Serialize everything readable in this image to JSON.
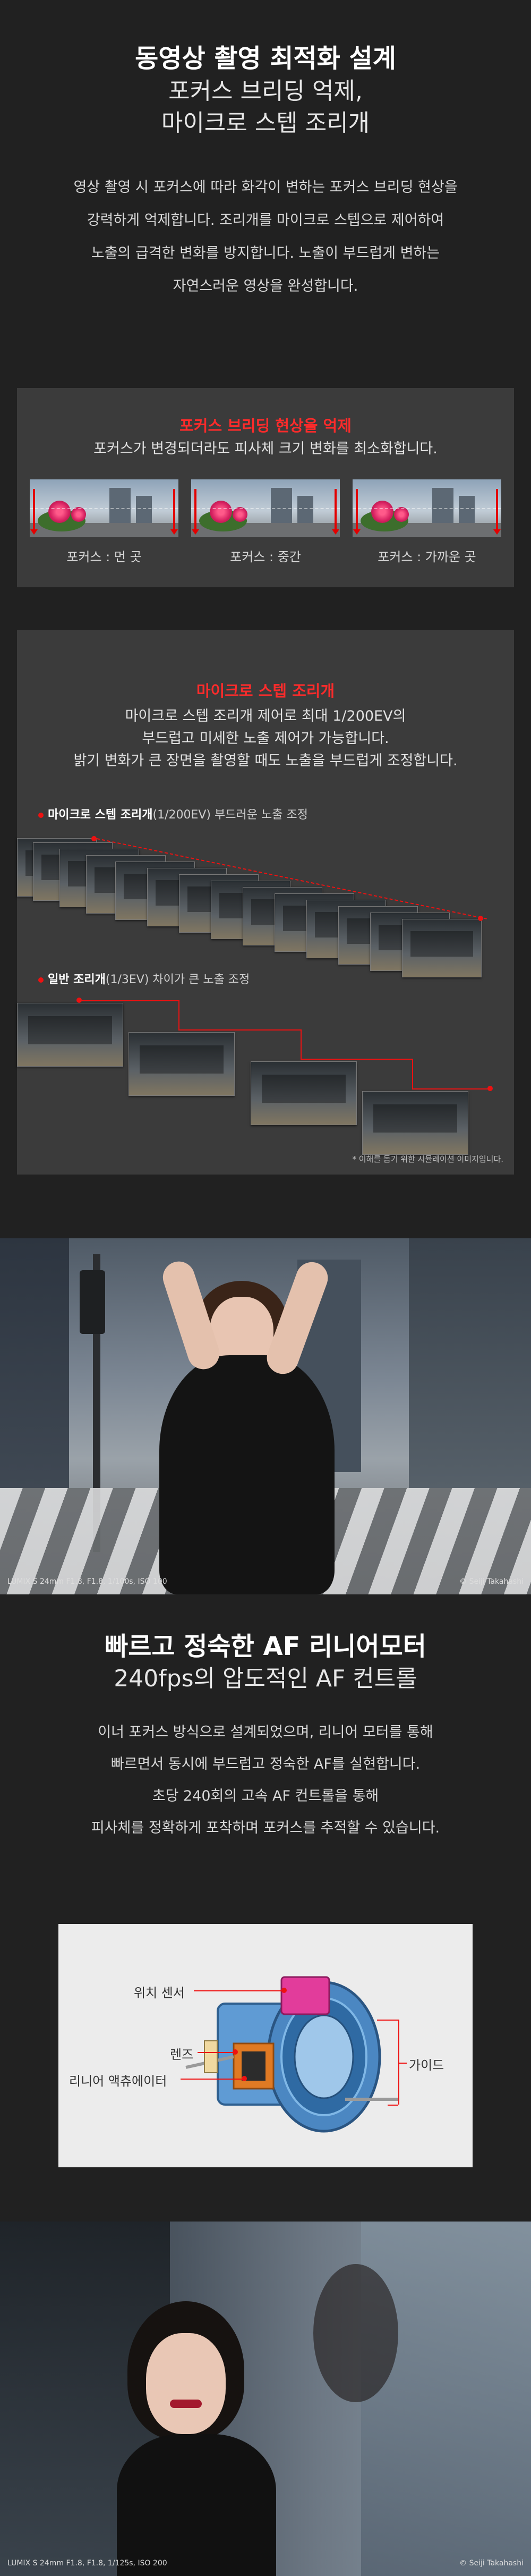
{
  "intro": {
    "title_bold": "동영상 촬영 최적화 설계",
    "title_line2": "포커스 브리딩 억제,",
    "title_line3": "마이크로 스텝 조리개",
    "body": [
      "영상 촬영 시 포커스에 따라 화각이 변하는 포커스 브리딩 현상을",
      "강력하게 억제합니다. 조리개를 마이크로 스텝으로 제어하여",
      "노출의 급격한 변화를 방지합니다. 노출이 부드럽게 변하는",
      "자연스러운 영상을 완성합니다."
    ]
  },
  "breathing": {
    "title": "포커스 브리딩 현상을 억제",
    "subtitle": "포커스가 변경되더라도 피사체 크기 변화를 최소화합니다.",
    "captions": [
      "포커스 : 먼 곳",
      "포커스 : 중간",
      "포커스 : 가까운 곳"
    ]
  },
  "aperture": {
    "title": "마이크로 스텝 조리개",
    "lines": [
      "마이크로 스텝 조리개 제어로 최대 1/200EV의",
      "부드럽고 미세한 노출 제어가 가능합니다.",
      "밝기 변화가 큰 장면을 촬영할 때도 노출을 부드럽게 조정합니다."
    ],
    "micro_label_bold": "마이크로 스텝 조리개",
    "micro_label_rest": "(1/200EV) 부드러운 노출 조정",
    "normal_label_bold": "일반 조리개",
    "normal_label_rest": "(1/3EV) 차이가 큰 노출 조정",
    "note": "* 이해를 돕기 위한 시뮬레이션 이미지입니다."
  },
  "photo1": {
    "credit_left": "LUMIX S 24mm F1.8, F1.8, 1/100s, ISO 100",
    "credit_right": "© Seiji Takahashi"
  },
  "af": {
    "title_bold": "빠르고 정숙한 AF 리니어모터",
    "title_line2": "240fps의 압도적인 AF 컨트롤",
    "body": [
      "이너 포커스 방식으로 설계되었으며, 리니어 모터를 통해",
      "빠르면서 동시에 부드럽고 정숙한 AF를 실현합니다.",
      "초당 240회의 고속 AF 컨트롤을 통해",
      "피사체를 정확하게 포착하며 포커스를 추적할 수 있습니다."
    ],
    "labels": {
      "sensor": "위치 센서",
      "lens": "렌즈",
      "actuator": "리니어 액츄에이터",
      "guide": "가이드"
    }
  },
  "photo2": {
    "credit_left": "LUMIX S 24mm F1.8, F1.8, 1/125s, ISO 200",
    "credit_right": "© Seiji Takahashi"
  }
}
